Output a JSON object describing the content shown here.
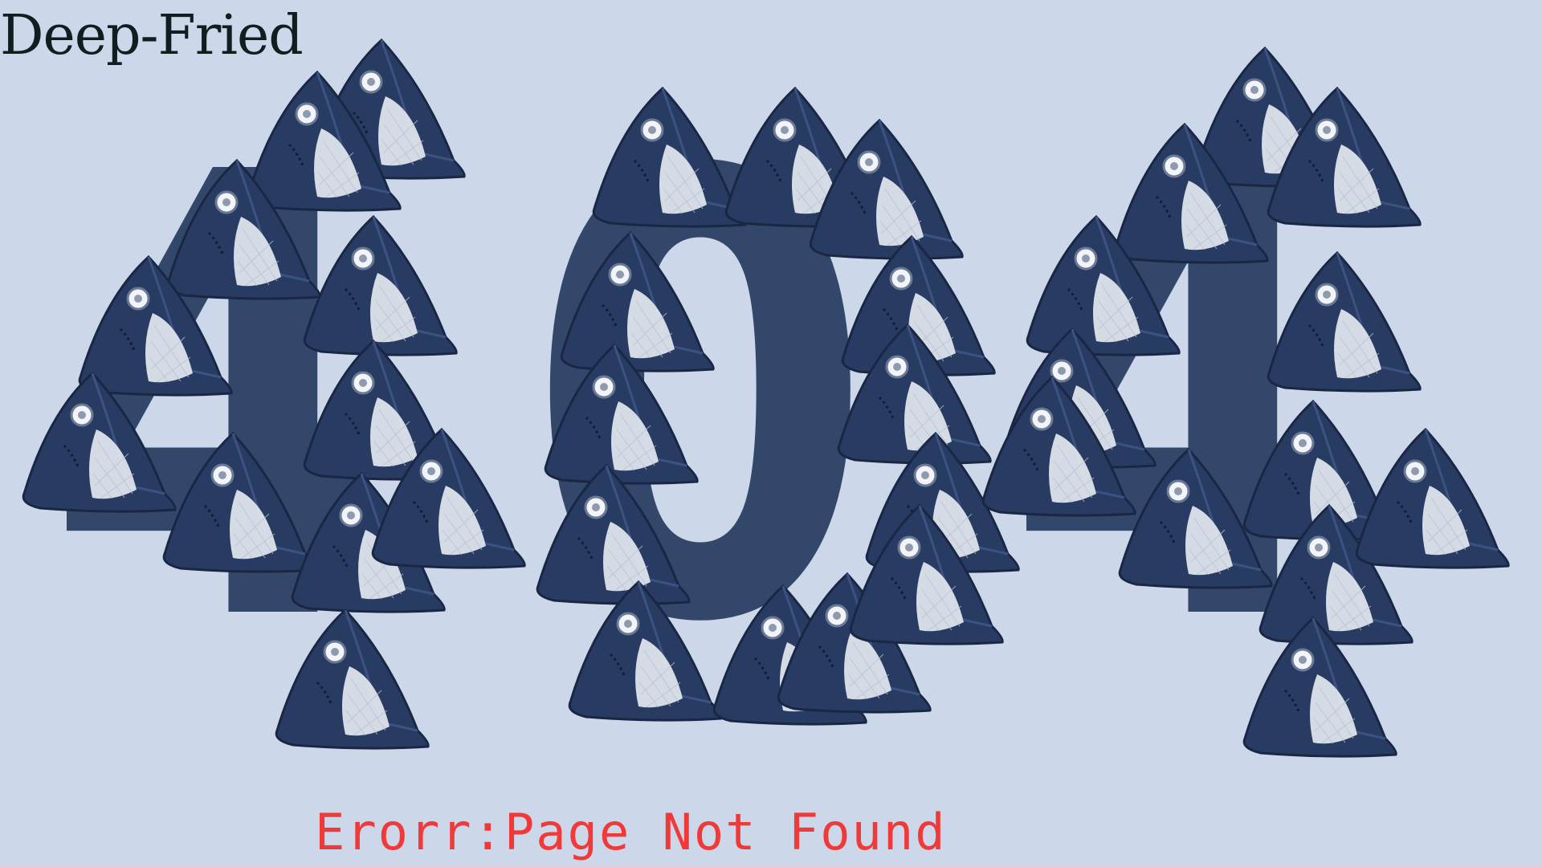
{
  "brand": {
    "logo_text": "Deep-Fried"
  },
  "error": {
    "code_digits": [
      "4",
      "0",
      "4"
    ],
    "message": "Erorr:Page Not Found"
  },
  "colors": {
    "background": "#ccd7e9",
    "digit": "#33476a",
    "mask_fabric": "#283c63",
    "mask_mesh": "#e8ecf2",
    "error_text": "#f03a3a"
  }
}
